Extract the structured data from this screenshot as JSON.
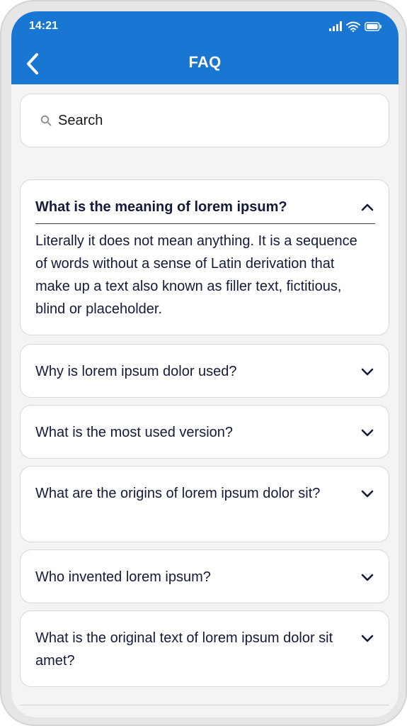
{
  "status_bar": {
    "time": "14:21",
    "icons": [
      "signal-icon",
      "wifi-icon",
      "battery-icon"
    ]
  },
  "header": {
    "title": "FAQ",
    "back_icon": "chevron-left-icon",
    "background": "#1976d2"
  },
  "search": {
    "placeholder": "Search",
    "value": ""
  },
  "faq": [
    {
      "question": "What is the meaning of lorem ipsum?",
      "answer": "Literally it does not mean anything. It is a sequence of words without a sense of Latin derivation that make up a text also known as filler text, fictitious, blind or placeholder.",
      "expanded": true
    },
    {
      "question": "Why is lorem ipsum dolor used?",
      "expanded": false
    },
    {
      "question": "What is the most used version?",
      "expanded": false
    },
    {
      "question": "What are the origins of lorem ipsum dolor sit?",
      "expanded": false
    },
    {
      "question": "Who invented lorem ipsum?",
      "expanded": false
    },
    {
      "question": "What is the original text of lorem ipsum dolor sit amet?",
      "expanded": false
    }
  ],
  "colors": {
    "accent": "#1976d2",
    "text": "#141b38",
    "card_border": "#d8d8d8",
    "background": "#f4f4f4"
  }
}
